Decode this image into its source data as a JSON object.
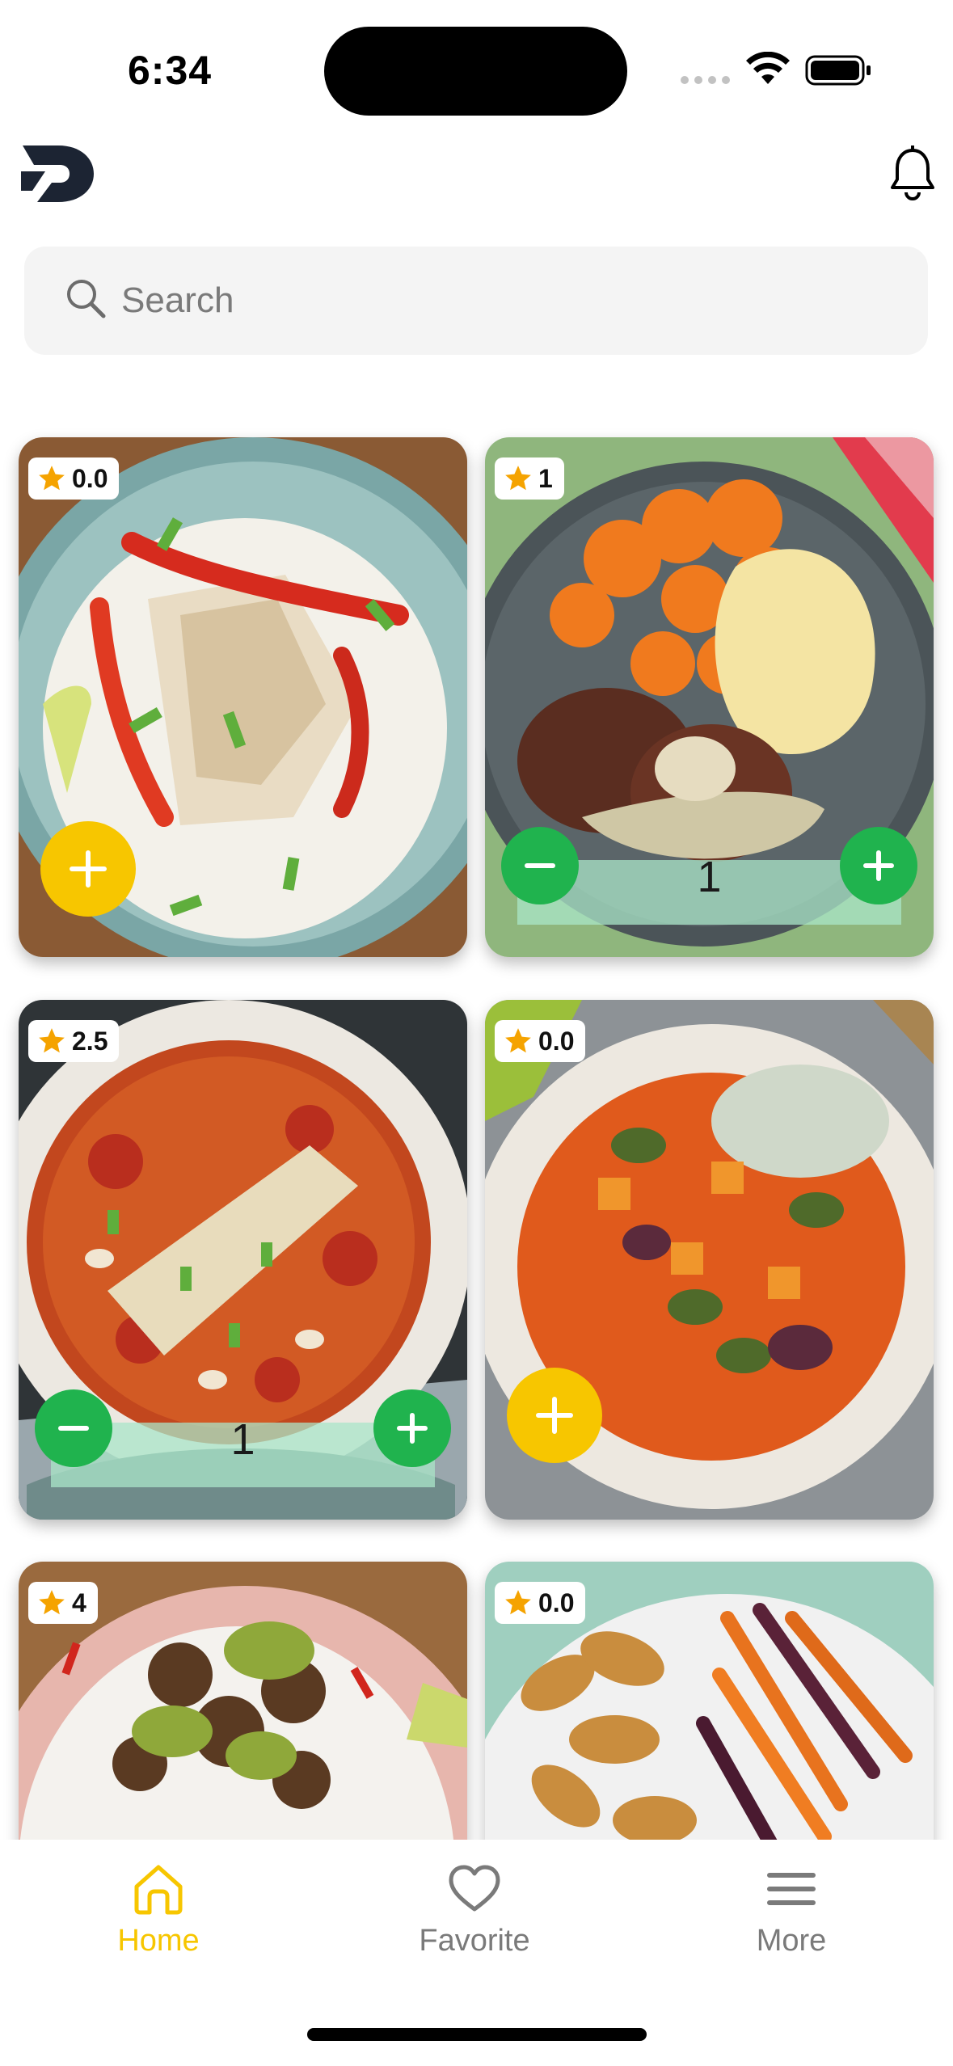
{
  "status_bar": {
    "time": "6:34"
  },
  "search": {
    "placeholder": "Search"
  },
  "colors": {
    "accent": "#F7C600",
    "green": "#20B34E",
    "tab_inactive": "#7A7A7A"
  },
  "recipes": [
    {
      "rating": "0.0",
      "in_cart": false,
      "quantity": ""
    },
    {
      "rating": "1",
      "in_cart": true,
      "quantity": "1"
    },
    {
      "rating": "2.5",
      "in_cart": true,
      "quantity": "1"
    },
    {
      "rating": "0.0",
      "in_cart": false,
      "quantity": ""
    },
    {
      "rating": "4",
      "in_cart": false,
      "quantity": ""
    },
    {
      "rating": "0.0",
      "in_cart": false,
      "quantity": ""
    }
  ],
  "tabs": [
    {
      "label": "Home",
      "icon": "home-icon",
      "active": true
    },
    {
      "label": "Favorite",
      "icon": "heart-icon",
      "active": false
    },
    {
      "label": "More",
      "icon": "menu-icon",
      "active": false
    }
  ]
}
